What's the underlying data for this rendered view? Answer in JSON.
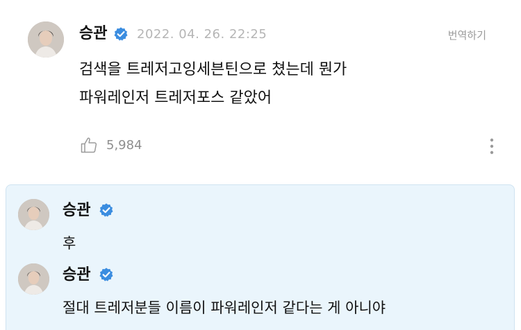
{
  "post": {
    "author": "승관",
    "timestamp": "2022. 04. 26. 22:25",
    "translate_label": "번역하기",
    "body": "검색을 트레저고잉세븐틴으로 쳤는데 뭔가\n파워레인저 트레저포스 같았어",
    "like_count": "5,984"
  },
  "replies": [
    {
      "author": "승관",
      "text": "후"
    },
    {
      "author": "승관",
      "text": "절대 트레저분들 이름이 파워레인저 같다는 게 아니야"
    }
  ],
  "colors": {
    "verified": "#3b8de0",
    "reply_background": "#eaf5fc",
    "muted_text": "#b5b5b5"
  }
}
